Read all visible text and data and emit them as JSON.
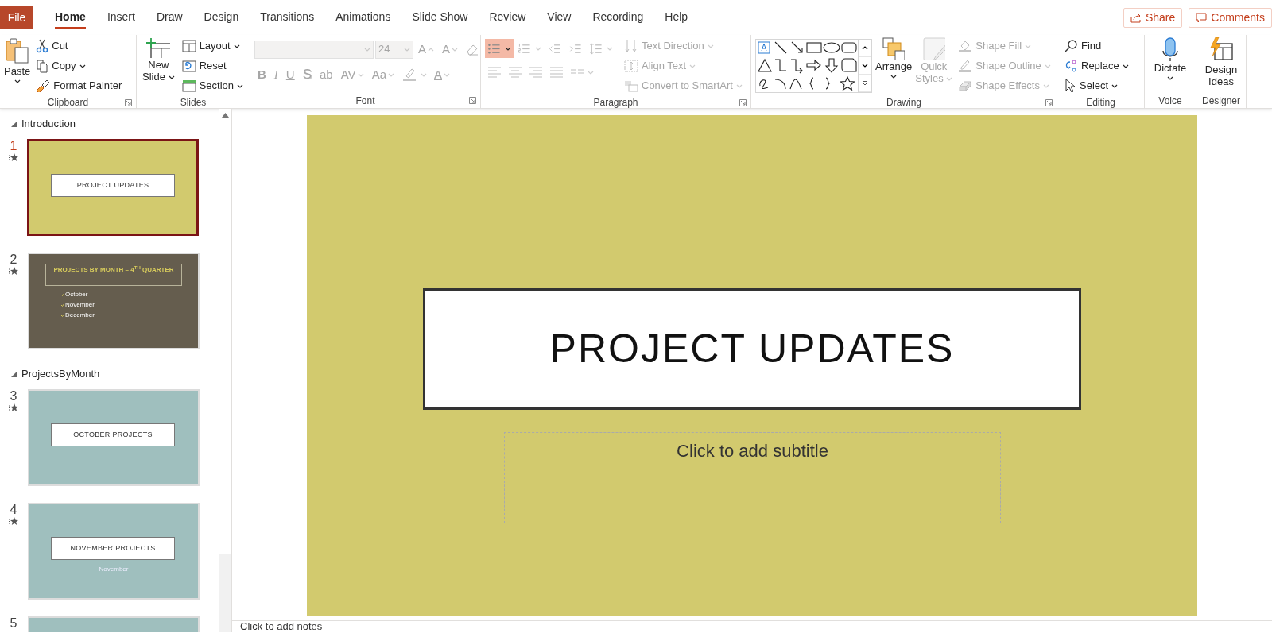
{
  "tabs": [
    {
      "label": "File",
      "kind": "backstage",
      "selected": false
    },
    {
      "label": "Home",
      "kind": "tab",
      "selected": true
    },
    {
      "label": "Insert",
      "kind": "tab",
      "selected": false
    },
    {
      "label": "Draw",
      "kind": "tab",
      "selected": false
    },
    {
      "label": "Design",
      "kind": "tab",
      "selected": false
    },
    {
      "label": "Transitions",
      "kind": "tab",
      "selected": false
    },
    {
      "label": "Animations",
      "kind": "tab",
      "selected": false
    },
    {
      "label": "Slide Show",
      "kind": "tab",
      "selected": false
    },
    {
      "label": "Review",
      "kind": "tab",
      "selected": false
    },
    {
      "label": "View",
      "kind": "tab",
      "selected": false
    },
    {
      "label": "Recording",
      "kind": "tab",
      "selected": false
    },
    {
      "label": "Help",
      "kind": "tab",
      "selected": false
    }
  ],
  "share": "Share",
  "comments": "Comments",
  "ribbon": {
    "clipboard": {
      "label": "Clipboard",
      "paste": "Paste",
      "cut": "Cut",
      "copy": "Copy",
      "format_painter": "Format Painter"
    },
    "slides": {
      "label": "Slides",
      "new_slide": "New Slide",
      "layout": "Layout",
      "reset": "Reset",
      "section": "Section"
    },
    "font": {
      "label": "Font",
      "disabled": true,
      "size": "24",
      "grow": "A",
      "shrink": "A",
      "font_color": "A",
      "styles": [
        {
          "label": "B",
          "kind": "bold"
        },
        {
          "label": "I",
          "kind": "italic"
        },
        {
          "label": "U",
          "kind": "underline"
        },
        {
          "label": "S",
          "kind": "shadow"
        },
        {
          "label": "ab",
          "kind": "strike"
        },
        {
          "label": "AV",
          "kind": "spacing"
        },
        {
          "label": "Aa",
          "kind": "case"
        }
      ]
    },
    "paragraph": {
      "label": "Paragraph",
      "disabled": true,
      "bullets_selected": true,
      "text_direction": "Text Direction",
      "align_text": "Align Text",
      "smartart": "Convert to SmartArt"
    },
    "drawing": {
      "label": "Drawing",
      "arrange": "Arrange",
      "quick_styles": {
        "label": "Quick Styles",
        "disabled": true
      },
      "shape_fill": {
        "label": "Shape Fill",
        "disabled": true
      },
      "shape_outline": {
        "label": "Shape Outline",
        "disabled": true
      },
      "shape_effects": {
        "label": "Shape Effects",
        "disabled": true
      }
    },
    "editing": {
      "label": "Editing",
      "find": "Find",
      "replace": "Replace",
      "select": "Select"
    },
    "voice": {
      "label": "Voice",
      "dictate": "Dictate"
    },
    "designer": {
      "label": "Designer",
      "design_ideas": "Design Ideas"
    }
  },
  "sections": [
    {
      "name": "Introduction",
      "expanded": true,
      "slides": [
        {
          "number": "1",
          "selected": true,
          "animated": true,
          "color": "#d2ca6e",
          "kind": "title",
          "title": "PROJECT UPDATES"
        },
        {
          "number": "2",
          "selected": false,
          "animated": true,
          "color": "#655d4e",
          "kind": "bullets",
          "title": "PROJECTS BY MONTH – 4$^{TH}$ QUARTER",
          "bullets": [
            "October",
            "November",
            "December"
          ]
        }
      ]
    },
    {
      "name": "ProjectsByMonth",
      "expanded": true,
      "slides": [
        {
          "number": "3",
          "selected": false,
          "animated": true,
          "color": "#9fbfbe",
          "kind": "title",
          "title": "OCTOBER PROJECTS"
        },
        {
          "number": "4",
          "selected": false,
          "animated": true,
          "color": "#9fbfbe",
          "kind": "title",
          "title": "NOVEMBER PROJECTS",
          "subtitle": "November"
        },
        {
          "number": "5",
          "selected": false,
          "animated": false,
          "color": "#9fbfbe",
          "kind": "blank"
        }
      ]
    }
  ],
  "slide": {
    "title": "PROJECT UPDATES",
    "subtitle_placeholder": "Click to add subtitle"
  },
  "notes": {
    "placeholder": "Click to add notes"
  }
}
